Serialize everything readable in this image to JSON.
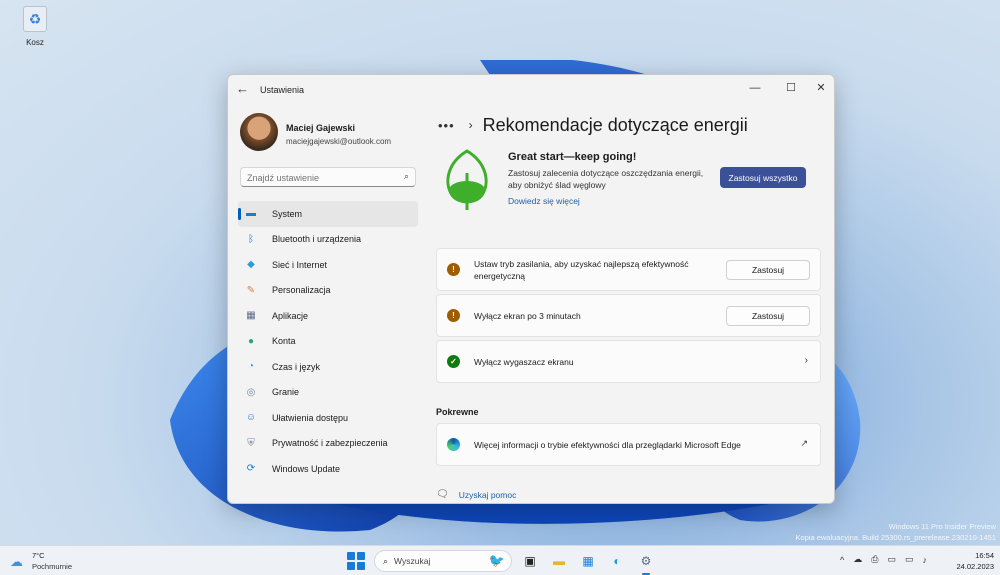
{
  "desktop": {
    "recycle_bin_label": "Kosz"
  },
  "window": {
    "title": "Ustawienia",
    "controls": {
      "minimize": "—",
      "maximize": "☐",
      "close": "✕"
    }
  },
  "profile": {
    "name": "Maciej Gajewski",
    "email": "maciejgajewski@outlook.com"
  },
  "search": {
    "placeholder": "Znajdź ustawienie"
  },
  "nav": {
    "items": [
      {
        "label": "System",
        "icon": "system-icon",
        "color": "#1a7ad8",
        "active": true
      },
      {
        "label": "Bluetooth i urządzenia",
        "icon": "bluetooth-icon",
        "color": "#1a7ad8"
      },
      {
        "label": "Sieć i Internet",
        "icon": "wifi-icon",
        "color": "#2b9be0"
      },
      {
        "label": "Personalizacja",
        "icon": "brush-icon",
        "color": "#e07a3a"
      },
      {
        "label": "Aplikacje",
        "icon": "apps-icon",
        "color": "#5a6b86"
      },
      {
        "label": "Konta",
        "icon": "person-icon",
        "color": "#2aa876"
      },
      {
        "label": "Czas i język",
        "icon": "globe-clock-icon",
        "color": "#2b9be0"
      },
      {
        "label": "Granie",
        "icon": "gamepad-icon",
        "color": "#7a8797"
      },
      {
        "label": "Ułatwienia dostępu",
        "icon": "accessibility-icon",
        "color": "#1a7ad8"
      },
      {
        "label": "Prywatność i zabezpieczenia",
        "icon": "shield-icon",
        "color": "#7a8797"
      },
      {
        "label": "Windows Update",
        "icon": "update-icon",
        "color": "#1a7ad8"
      }
    ]
  },
  "breadcrumb": {
    "more": "•••",
    "title": "Rekomendacje dotyczące energii"
  },
  "hero": {
    "heading": "Great start—keep going!",
    "description": "Zastosuj zalecenia dotyczące oszczędzania energii, aby obniżyć ślad węglowy",
    "link": "Dowiedz się więcej",
    "apply_all": "Zastosuj wszystko",
    "leaf_color": "#3fae2a"
  },
  "recommendations": [
    {
      "status": "warning",
      "text": "Ustaw tryb zasilania, aby uzyskać najlepszą efektywność energetyczną",
      "button": "Zastosuj"
    },
    {
      "status": "warning",
      "text": "Wyłącz ekran po 3 minutach",
      "button": "Zastosuj"
    },
    {
      "status": "done",
      "text": "Wyłącz wygaszacz ekranu"
    }
  ],
  "related": {
    "heading": "Pokrewne",
    "edge_link": "Więcej informacji o trybie efektywności dla przeglądarki Microsoft Edge"
  },
  "help": {
    "label": "Uzyskaj pomoc"
  },
  "watermark": {
    "line1": "Windows 11 Pro Insider Preview",
    "line2": "Kopia ewaluacyjna. Build 25300.rs_prerelease.230210-1451"
  },
  "taskbar": {
    "weather_temp": "7°C",
    "weather_desc": "Pochmurnie",
    "search_label": "Wyszukaj",
    "time": "16:54",
    "date": "24.02.2023"
  }
}
